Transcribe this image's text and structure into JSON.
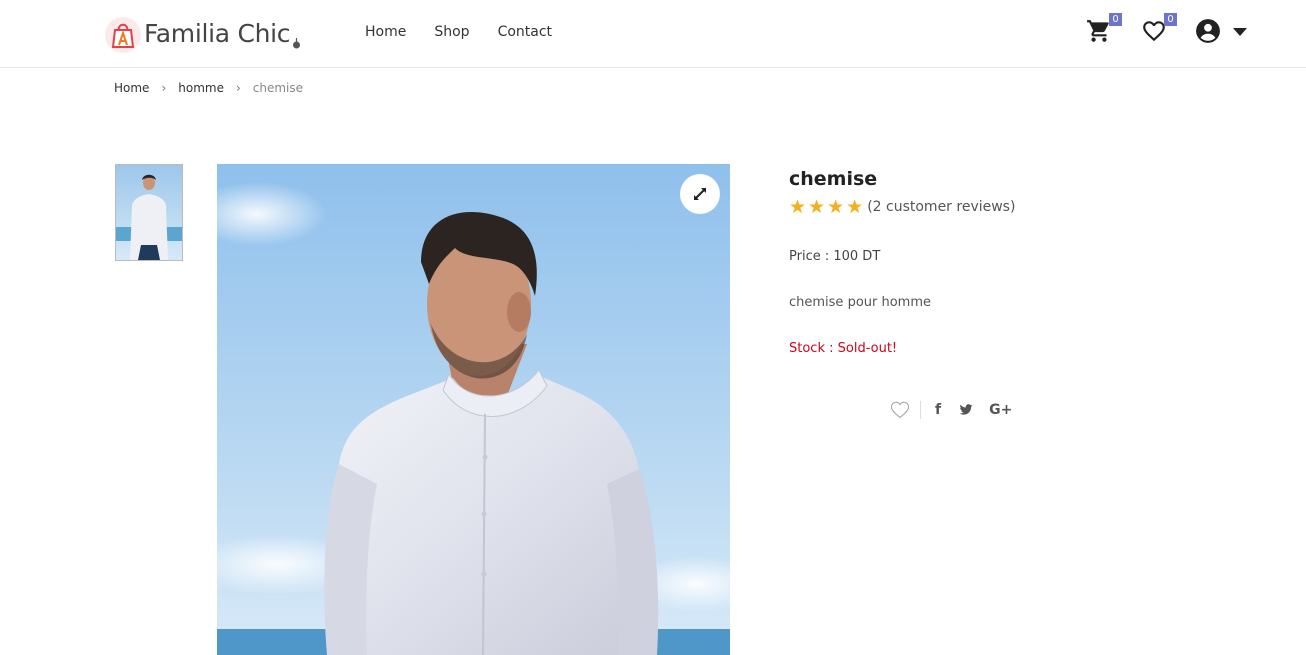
{
  "header": {
    "logo_text": "Familia Chic",
    "nav": [
      "Home",
      "Shop",
      "Contact"
    ],
    "cart_count": "0",
    "wishlist_count": "0"
  },
  "breadcrumb": [
    "Home",
    "homme",
    "chemise"
  ],
  "product": {
    "title": "chemise",
    "rating_stars": 4,
    "reviews_text": "(2 customer reviews)",
    "price_text": "Price : 100 DT",
    "description": "chemise pour homme",
    "stock_text": "Stock : Sold-out!"
  },
  "social": {
    "facebook": "f",
    "google": "G+"
  },
  "colors": {
    "accent_badge": "#6c75c9",
    "star": "#f2b01e",
    "stock_red": "#d0021b",
    "logo_red": "#e8404a"
  },
  "icons": [
    "cart-icon",
    "heart-icon",
    "user-circle-icon",
    "caret-down-icon",
    "expand-icon",
    "wishlist-heart-icon",
    "facebook-icon",
    "twitter-icon",
    "google-plus-icon"
  ]
}
